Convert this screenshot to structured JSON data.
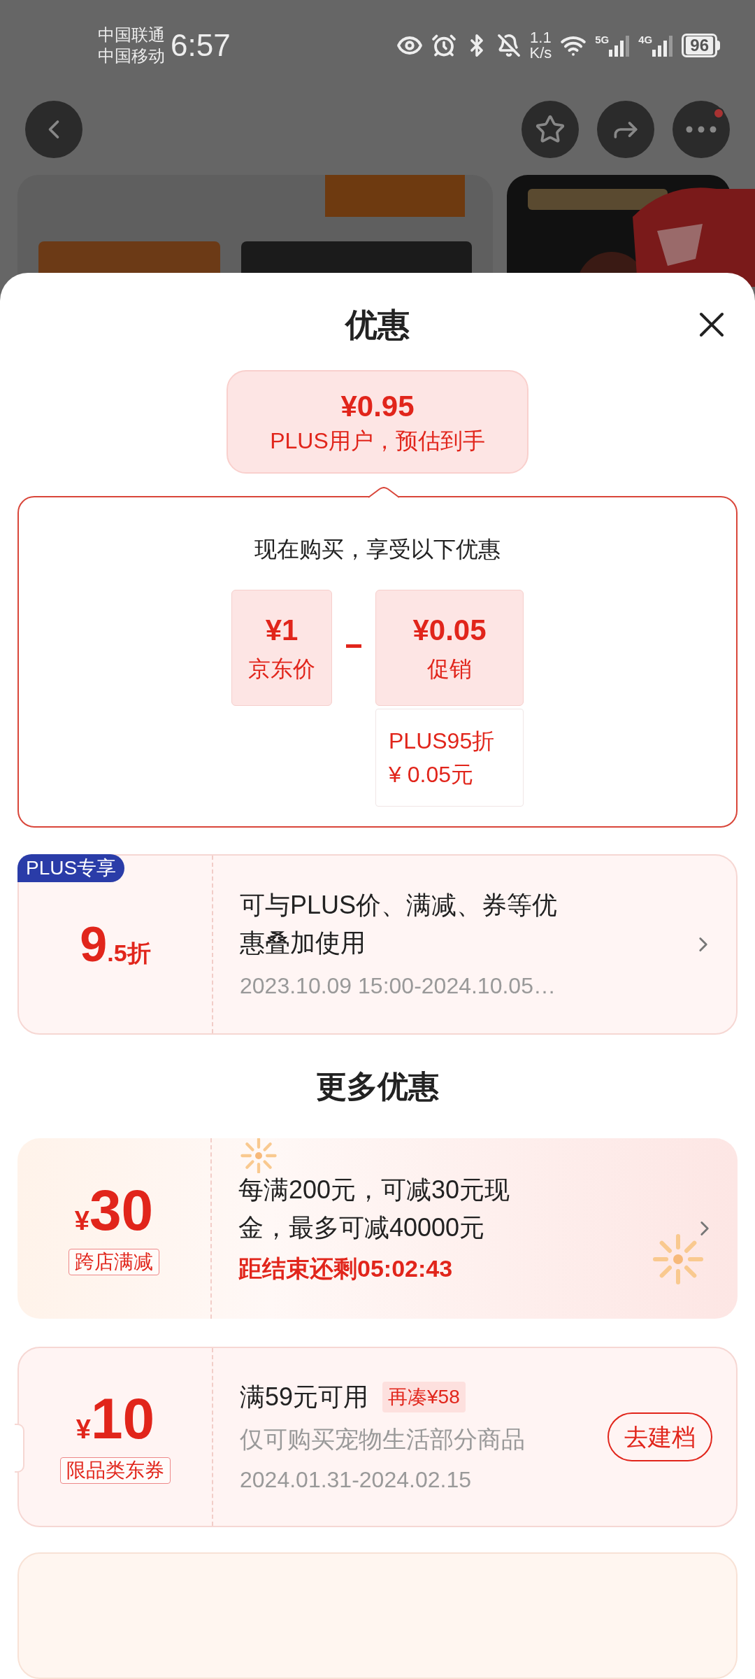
{
  "status_bar": {
    "carriers": [
      "中国联通",
      "中国移动"
    ],
    "time": "6:57",
    "net_speed": [
      "1.1",
      "K/s"
    ],
    "signals": [
      "5G",
      "4G"
    ],
    "battery": "96"
  },
  "header": {
    "notification_dot": true
  },
  "sheet": {
    "title": "优惠"
  },
  "estimate": {
    "price": "¥0.95",
    "caption": "PLUS用户，预估到手"
  },
  "breakdown": {
    "heading": "现在购买，享受以下优惠",
    "items": [
      {
        "amount": "¥1",
        "label": "京东价"
      },
      {
        "amount": "¥0.05",
        "label": "促销",
        "details": [
          "PLUS95折",
          "¥ 0.05元"
        ]
      }
    ]
  },
  "plus_offer": {
    "badge": "PLUS专享",
    "discount_main": "9",
    "discount_rest": ".5折",
    "description": "可与PLUS价、满减、券等优惠叠加使用",
    "period": "2023.10.09 15:00-2024.10.05…"
  },
  "more": {
    "title": "更多优惠",
    "offers": [
      {
        "kind": "promo",
        "currency": "¥",
        "amount": "30",
        "tag": "跨店满减",
        "description": "每满200元，可减30元现金，最多可减40000元",
        "countdown": "距结束还剩05:02:43"
      },
      {
        "kind": "coupon",
        "currency": "¥",
        "amount": "10",
        "tag": "限品类东券",
        "condition": "满59元可用",
        "gap": "再凑¥58",
        "scope": "仅可购买宠物生活部分商品",
        "period": "2024.01.31-2024.02.15",
        "action": "去建档"
      }
    ]
  }
}
